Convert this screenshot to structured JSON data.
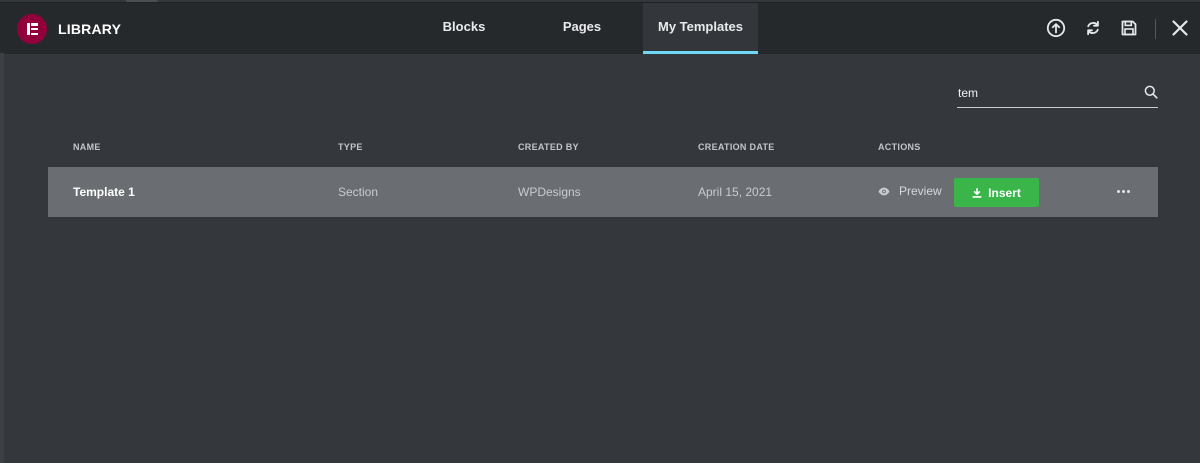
{
  "header": {
    "title": "LIBRARY",
    "tabs": [
      {
        "label": "Blocks",
        "active": false
      },
      {
        "label": "Pages",
        "active": false
      },
      {
        "label": "My Templates",
        "active": true
      }
    ],
    "icons": [
      "upload-icon",
      "sync-icon",
      "save-icon",
      "close-icon"
    ]
  },
  "search": {
    "value": "tem",
    "icon": "search-icon"
  },
  "table": {
    "columns": [
      "NAME",
      "TYPE",
      "CREATED BY",
      "CREATION DATE",
      "ACTIONS"
    ],
    "rows": [
      {
        "name": "Template 1",
        "type": "Section",
        "created_by": "WPDesigns",
        "creation_date": "April 15, 2021",
        "preview_label": "Preview",
        "insert_label": "Insert"
      }
    ]
  },
  "colors": {
    "logo": "#92003b",
    "accent_tab": "#71d7f7",
    "insert_button": "#39b54a",
    "header_bg": "#26292c",
    "body_bg": "#34383c",
    "row_bg": "#6a6d71"
  }
}
